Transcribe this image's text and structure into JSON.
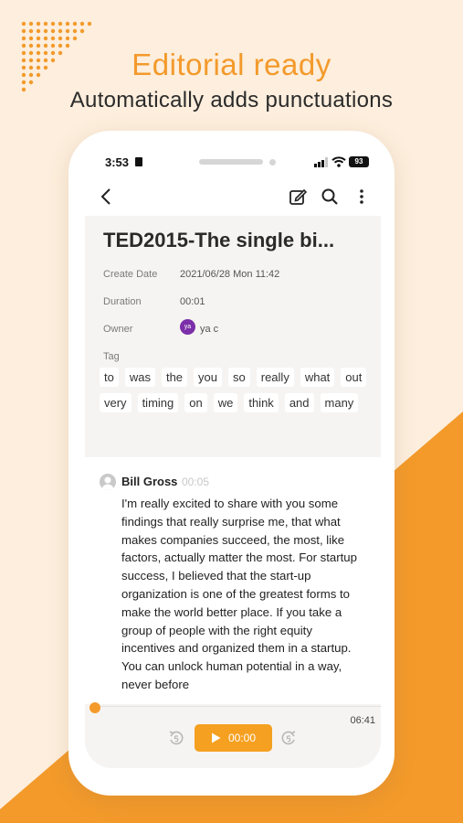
{
  "banner": {
    "headline": "Editorial ready",
    "subline": "Automatically adds punctuations"
  },
  "status_bar": {
    "time": "3:53",
    "battery": "93"
  },
  "toolbar": {
    "back_icon": "chevron-left-icon",
    "edit_icon": "edit-icon",
    "search_icon": "search-icon",
    "more_icon": "more-vertical-icon"
  },
  "record": {
    "title": "TED2015-The single bi...",
    "create_date_label": "Create Date",
    "create_date_value": "2021/06/28 Mon 11:42",
    "duration_label": "Duration",
    "duration_value": "00:01",
    "owner_label": "Owner",
    "owner_avatar_text": "ya",
    "owner_name": "ya c",
    "tag_label": "Tag",
    "tags": [
      "to",
      "was",
      "the",
      "you",
      "so",
      "really",
      "what",
      "out",
      "very",
      "timing",
      "on",
      "we",
      "think",
      "and",
      "many"
    ]
  },
  "transcript": {
    "speaker": "Bill Gross",
    "timestamp": "00:05",
    "text": "I'm really excited to share with you some findings that really surprise me, that what makes companies succeed, the most, like factors, actually matter the most. For startup success, I believed that the start-up organization is one of the greatest forms to make the world better place. If you take a group of people with the right equity incentives and organized them in a startup. You can unlock human potential in a way, never before"
  },
  "player": {
    "current_time": "00:00",
    "total_time": "06:41",
    "progress": 0,
    "rewind_icon": "rewind-5-icon",
    "forward_icon": "forward-5-icon",
    "play_icon": "play-icon"
  },
  "colors": {
    "accent": "#f39a2b",
    "background": "#fdeedd",
    "owner_avatar": "#7b2fa8"
  }
}
